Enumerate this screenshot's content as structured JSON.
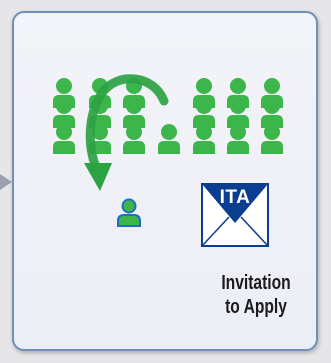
{
  "envelope": {
    "code": "ITA",
    "color": "#0b3d91"
  },
  "caption": {
    "line1": "Invitation",
    "line2": "to Apply"
  },
  "colors": {
    "person_green": "#3cb54a",
    "arrow_green": "#2ca343",
    "selected_outline": "#1f6fc0",
    "card_border": "#6e8fb8"
  },
  "icons": {
    "person": "person-icon",
    "arrow": "curved-arrow-icon",
    "envelope": "envelope-icon"
  }
}
